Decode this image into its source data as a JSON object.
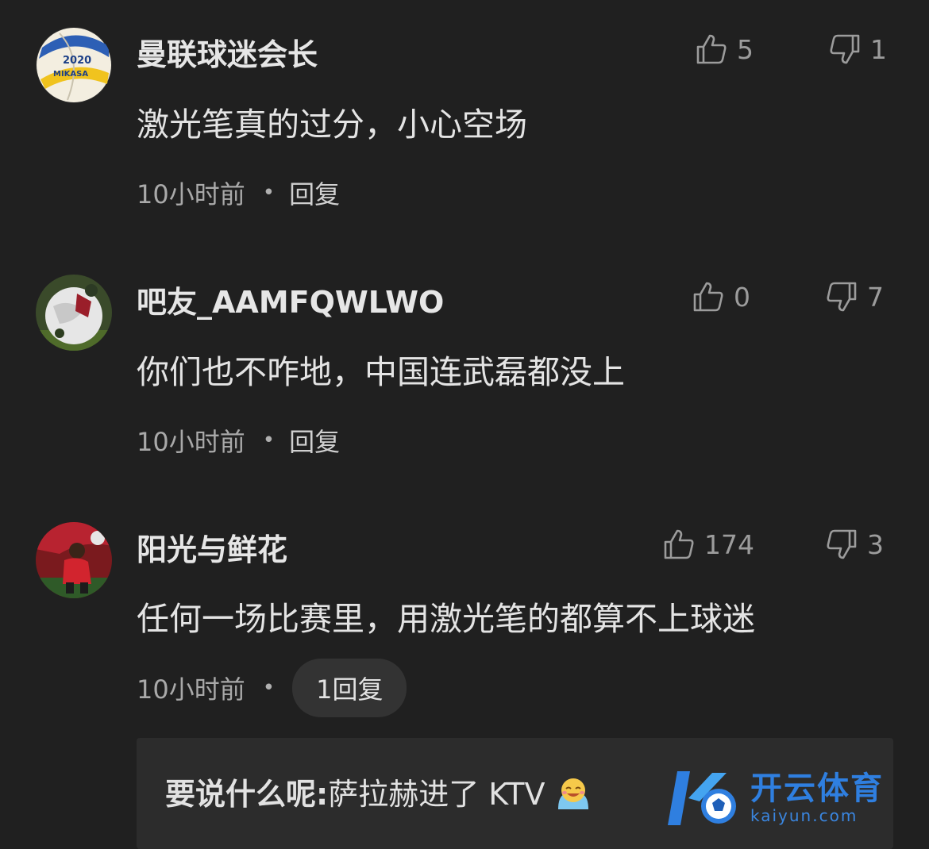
{
  "comments": [
    {
      "username": "曼联球迷会长",
      "content": "激光笔真的过分，小心空场",
      "time": "10小时前",
      "reply_label": "回复",
      "likes": "5",
      "dislikes": "1",
      "avatar": "volleyball-avatar"
    },
    {
      "username": "吧友_AAMFQWLWO",
      "content": "你们也不咋地，中国连武磊都没上",
      "time": "10小时前",
      "reply_label": "回复",
      "likes": "0",
      "dislikes": "7",
      "avatar": "football-avatar"
    },
    {
      "username": "阳光与鲜花",
      "content": "任何一场比赛里，用激光笔的都算不上球迷",
      "time": "10小时前",
      "reply_label": "1回复",
      "likes": "174",
      "dislikes": "3",
      "avatar": "player-avatar"
    }
  ],
  "reply_preview": {
    "author": "要说什么呢:",
    "text": "萨拉赫进了 KTV",
    "emoji": "laughing-emoji"
  },
  "watermark": {
    "cn": "开云体育",
    "en": "kaiyun.com"
  },
  "colors": {
    "background": "#202020",
    "text": "#e4e4e4",
    "muted": "#a9a9a9",
    "brand": "#2f7fe0"
  }
}
